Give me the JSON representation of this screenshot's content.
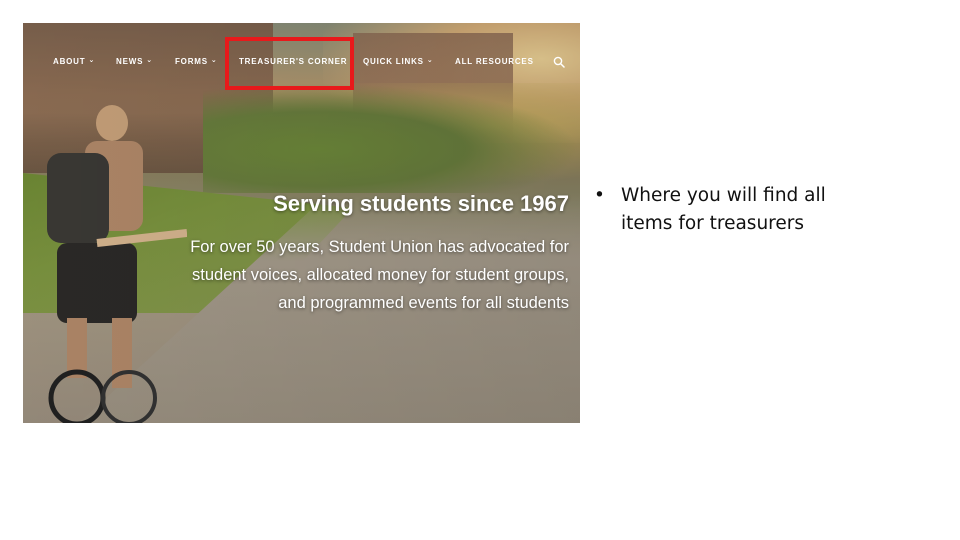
{
  "nav": {
    "items": [
      {
        "label": "ABOUT",
        "has_dropdown": true
      },
      {
        "label": "NEWS",
        "has_dropdown": true
      },
      {
        "label": "FORMS",
        "has_dropdown": true
      },
      {
        "label": "TREASURER'S CORNER",
        "has_dropdown": false
      },
      {
        "label": "QUICK LINKS",
        "has_dropdown": true
      },
      {
        "label": "ALL RESOURCES",
        "has_dropdown": false
      }
    ],
    "chevron_icon": "chevron-down-icon",
    "search_icon": "search-icon"
  },
  "hero": {
    "title": "Serving students since 1967",
    "body": "For over 50 years, Student Union has advocated for student voices, allocated money for student groups, and programmed events for all students"
  },
  "annotation": {
    "highlight_color": "#e8191b",
    "highlighted_item": "TREASURER'S CORNER"
  },
  "slide": {
    "bullet_char": "•",
    "bullet_text": "Where you will find all items for treasurers"
  }
}
